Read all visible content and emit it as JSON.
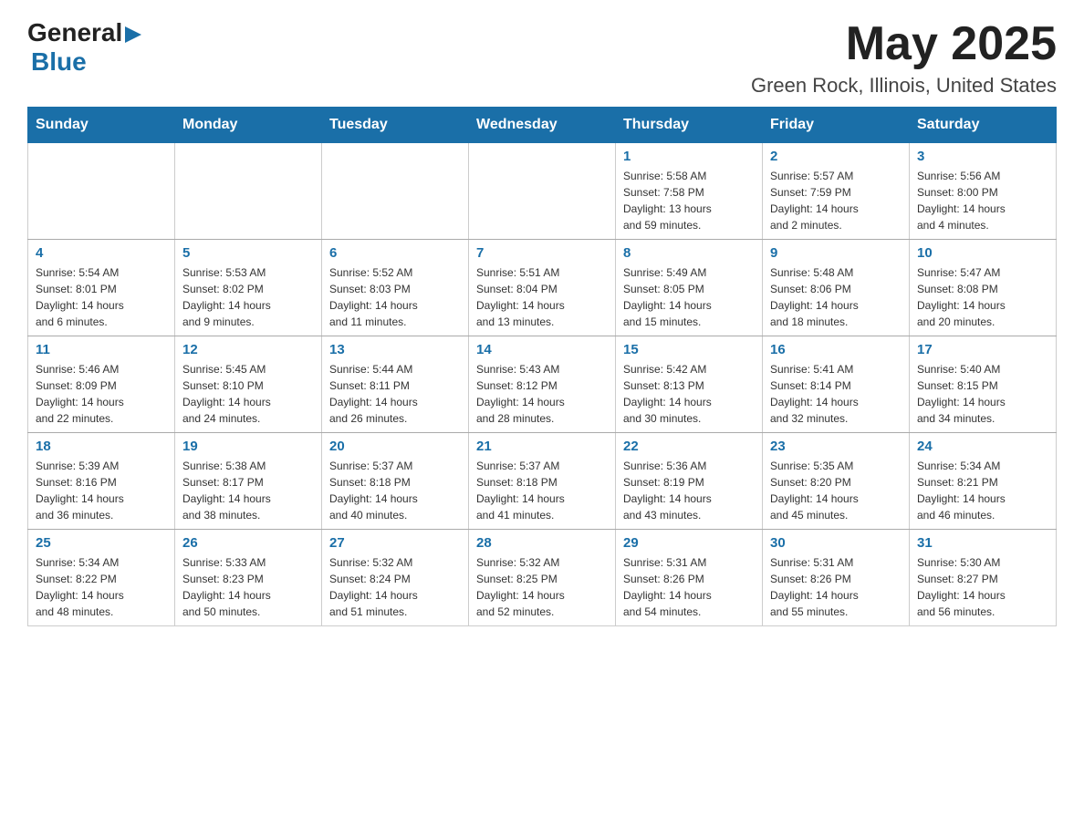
{
  "header": {
    "logo_general": "General",
    "logo_blue": "Blue",
    "title": "May 2025",
    "subtitle": "Green Rock, Illinois, United States"
  },
  "calendar": {
    "days_of_week": [
      "Sunday",
      "Monday",
      "Tuesday",
      "Wednesday",
      "Thursday",
      "Friday",
      "Saturday"
    ],
    "weeks": [
      [
        {
          "day": "",
          "info": ""
        },
        {
          "day": "",
          "info": ""
        },
        {
          "day": "",
          "info": ""
        },
        {
          "day": "",
          "info": ""
        },
        {
          "day": "1",
          "info": "Sunrise: 5:58 AM\nSunset: 7:58 PM\nDaylight: 13 hours\nand 59 minutes."
        },
        {
          "day": "2",
          "info": "Sunrise: 5:57 AM\nSunset: 7:59 PM\nDaylight: 14 hours\nand 2 minutes."
        },
        {
          "day": "3",
          "info": "Sunrise: 5:56 AM\nSunset: 8:00 PM\nDaylight: 14 hours\nand 4 minutes."
        }
      ],
      [
        {
          "day": "4",
          "info": "Sunrise: 5:54 AM\nSunset: 8:01 PM\nDaylight: 14 hours\nand 6 minutes."
        },
        {
          "day": "5",
          "info": "Sunrise: 5:53 AM\nSunset: 8:02 PM\nDaylight: 14 hours\nand 9 minutes."
        },
        {
          "day": "6",
          "info": "Sunrise: 5:52 AM\nSunset: 8:03 PM\nDaylight: 14 hours\nand 11 minutes."
        },
        {
          "day": "7",
          "info": "Sunrise: 5:51 AM\nSunset: 8:04 PM\nDaylight: 14 hours\nand 13 minutes."
        },
        {
          "day": "8",
          "info": "Sunrise: 5:49 AM\nSunset: 8:05 PM\nDaylight: 14 hours\nand 15 minutes."
        },
        {
          "day": "9",
          "info": "Sunrise: 5:48 AM\nSunset: 8:06 PM\nDaylight: 14 hours\nand 18 minutes."
        },
        {
          "day": "10",
          "info": "Sunrise: 5:47 AM\nSunset: 8:08 PM\nDaylight: 14 hours\nand 20 minutes."
        }
      ],
      [
        {
          "day": "11",
          "info": "Sunrise: 5:46 AM\nSunset: 8:09 PM\nDaylight: 14 hours\nand 22 minutes."
        },
        {
          "day": "12",
          "info": "Sunrise: 5:45 AM\nSunset: 8:10 PM\nDaylight: 14 hours\nand 24 minutes."
        },
        {
          "day": "13",
          "info": "Sunrise: 5:44 AM\nSunset: 8:11 PM\nDaylight: 14 hours\nand 26 minutes."
        },
        {
          "day": "14",
          "info": "Sunrise: 5:43 AM\nSunset: 8:12 PM\nDaylight: 14 hours\nand 28 minutes."
        },
        {
          "day": "15",
          "info": "Sunrise: 5:42 AM\nSunset: 8:13 PM\nDaylight: 14 hours\nand 30 minutes."
        },
        {
          "day": "16",
          "info": "Sunrise: 5:41 AM\nSunset: 8:14 PM\nDaylight: 14 hours\nand 32 minutes."
        },
        {
          "day": "17",
          "info": "Sunrise: 5:40 AM\nSunset: 8:15 PM\nDaylight: 14 hours\nand 34 minutes."
        }
      ],
      [
        {
          "day": "18",
          "info": "Sunrise: 5:39 AM\nSunset: 8:16 PM\nDaylight: 14 hours\nand 36 minutes."
        },
        {
          "day": "19",
          "info": "Sunrise: 5:38 AM\nSunset: 8:17 PM\nDaylight: 14 hours\nand 38 minutes."
        },
        {
          "day": "20",
          "info": "Sunrise: 5:37 AM\nSunset: 8:18 PM\nDaylight: 14 hours\nand 40 minutes."
        },
        {
          "day": "21",
          "info": "Sunrise: 5:37 AM\nSunset: 8:18 PM\nDaylight: 14 hours\nand 41 minutes."
        },
        {
          "day": "22",
          "info": "Sunrise: 5:36 AM\nSunset: 8:19 PM\nDaylight: 14 hours\nand 43 minutes."
        },
        {
          "day": "23",
          "info": "Sunrise: 5:35 AM\nSunset: 8:20 PM\nDaylight: 14 hours\nand 45 minutes."
        },
        {
          "day": "24",
          "info": "Sunrise: 5:34 AM\nSunset: 8:21 PM\nDaylight: 14 hours\nand 46 minutes."
        }
      ],
      [
        {
          "day": "25",
          "info": "Sunrise: 5:34 AM\nSunset: 8:22 PM\nDaylight: 14 hours\nand 48 minutes."
        },
        {
          "day": "26",
          "info": "Sunrise: 5:33 AM\nSunset: 8:23 PM\nDaylight: 14 hours\nand 50 minutes."
        },
        {
          "day": "27",
          "info": "Sunrise: 5:32 AM\nSunset: 8:24 PM\nDaylight: 14 hours\nand 51 minutes."
        },
        {
          "day": "28",
          "info": "Sunrise: 5:32 AM\nSunset: 8:25 PM\nDaylight: 14 hours\nand 52 minutes."
        },
        {
          "day": "29",
          "info": "Sunrise: 5:31 AM\nSunset: 8:26 PM\nDaylight: 14 hours\nand 54 minutes."
        },
        {
          "day": "30",
          "info": "Sunrise: 5:31 AM\nSunset: 8:26 PM\nDaylight: 14 hours\nand 55 minutes."
        },
        {
          "day": "31",
          "info": "Sunrise: 5:30 AM\nSunset: 8:27 PM\nDaylight: 14 hours\nand 56 minutes."
        }
      ]
    ]
  }
}
